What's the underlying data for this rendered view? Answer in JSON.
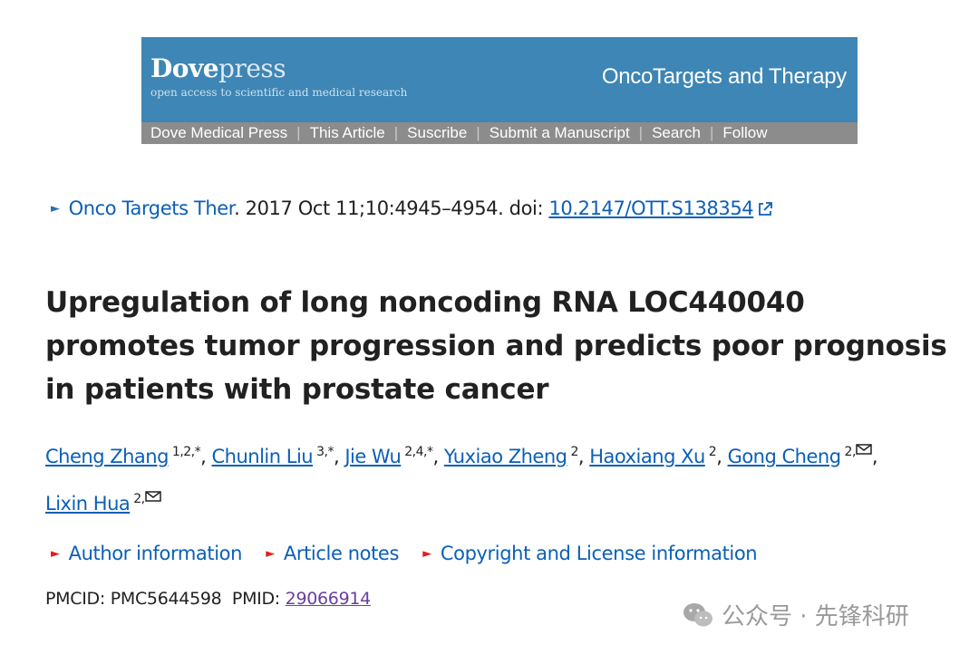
{
  "banner": {
    "logo_main": "Dove",
    "logo_accent": "press",
    "tagline": "open access to scientific and medical research",
    "journal": "OncoTargets and Therapy",
    "nav": [
      "Dove Medical Press",
      "This Article",
      "Suscribe",
      "Submit a Manuscript",
      "Search",
      "Follow"
    ]
  },
  "citation": {
    "journal_link": "Onco Targets Ther",
    "details": ". 2017 Oct 11;10:4945–4954. doi: ",
    "doi": "10.2147/OTT.S138354"
  },
  "article": {
    "title": "Upregulation of long noncoding RNA LOC440040 promotes tumor progression and predicts poor prognosis in patients with prostate cancer"
  },
  "authors": [
    {
      "name": "Cheng Zhang",
      "aff": "1,2,*"
    },
    {
      "name": "Chunlin Liu",
      "aff": "3,*"
    },
    {
      "name": "Jie Wu",
      "aff": "2,4,*"
    },
    {
      "name": "Yuxiao Zheng",
      "aff": "2"
    },
    {
      "name": "Haoxiang Xu",
      "aff": "2"
    },
    {
      "name": "Gong Cheng",
      "aff": "2,"
    },
    {
      "name": "Lixin Hua",
      "aff": "2,"
    }
  ],
  "info_links": [
    "Author information",
    "Article notes",
    "Copyright and License information"
  ],
  "ids": {
    "pmcid_label": "PMCID: PMC5644598",
    "pmid_label": "PMID: ",
    "pmid": "29066914"
  },
  "watermark": {
    "text": "公众号 · 先锋科研",
    "icon": "wechat-icon"
  },
  "colors": {
    "banner": "#3d86b5",
    "nav": "#8c8c8c",
    "link": "#0b5fb8",
    "visited": "#6b3fa0",
    "marker_red": "#e02020"
  }
}
